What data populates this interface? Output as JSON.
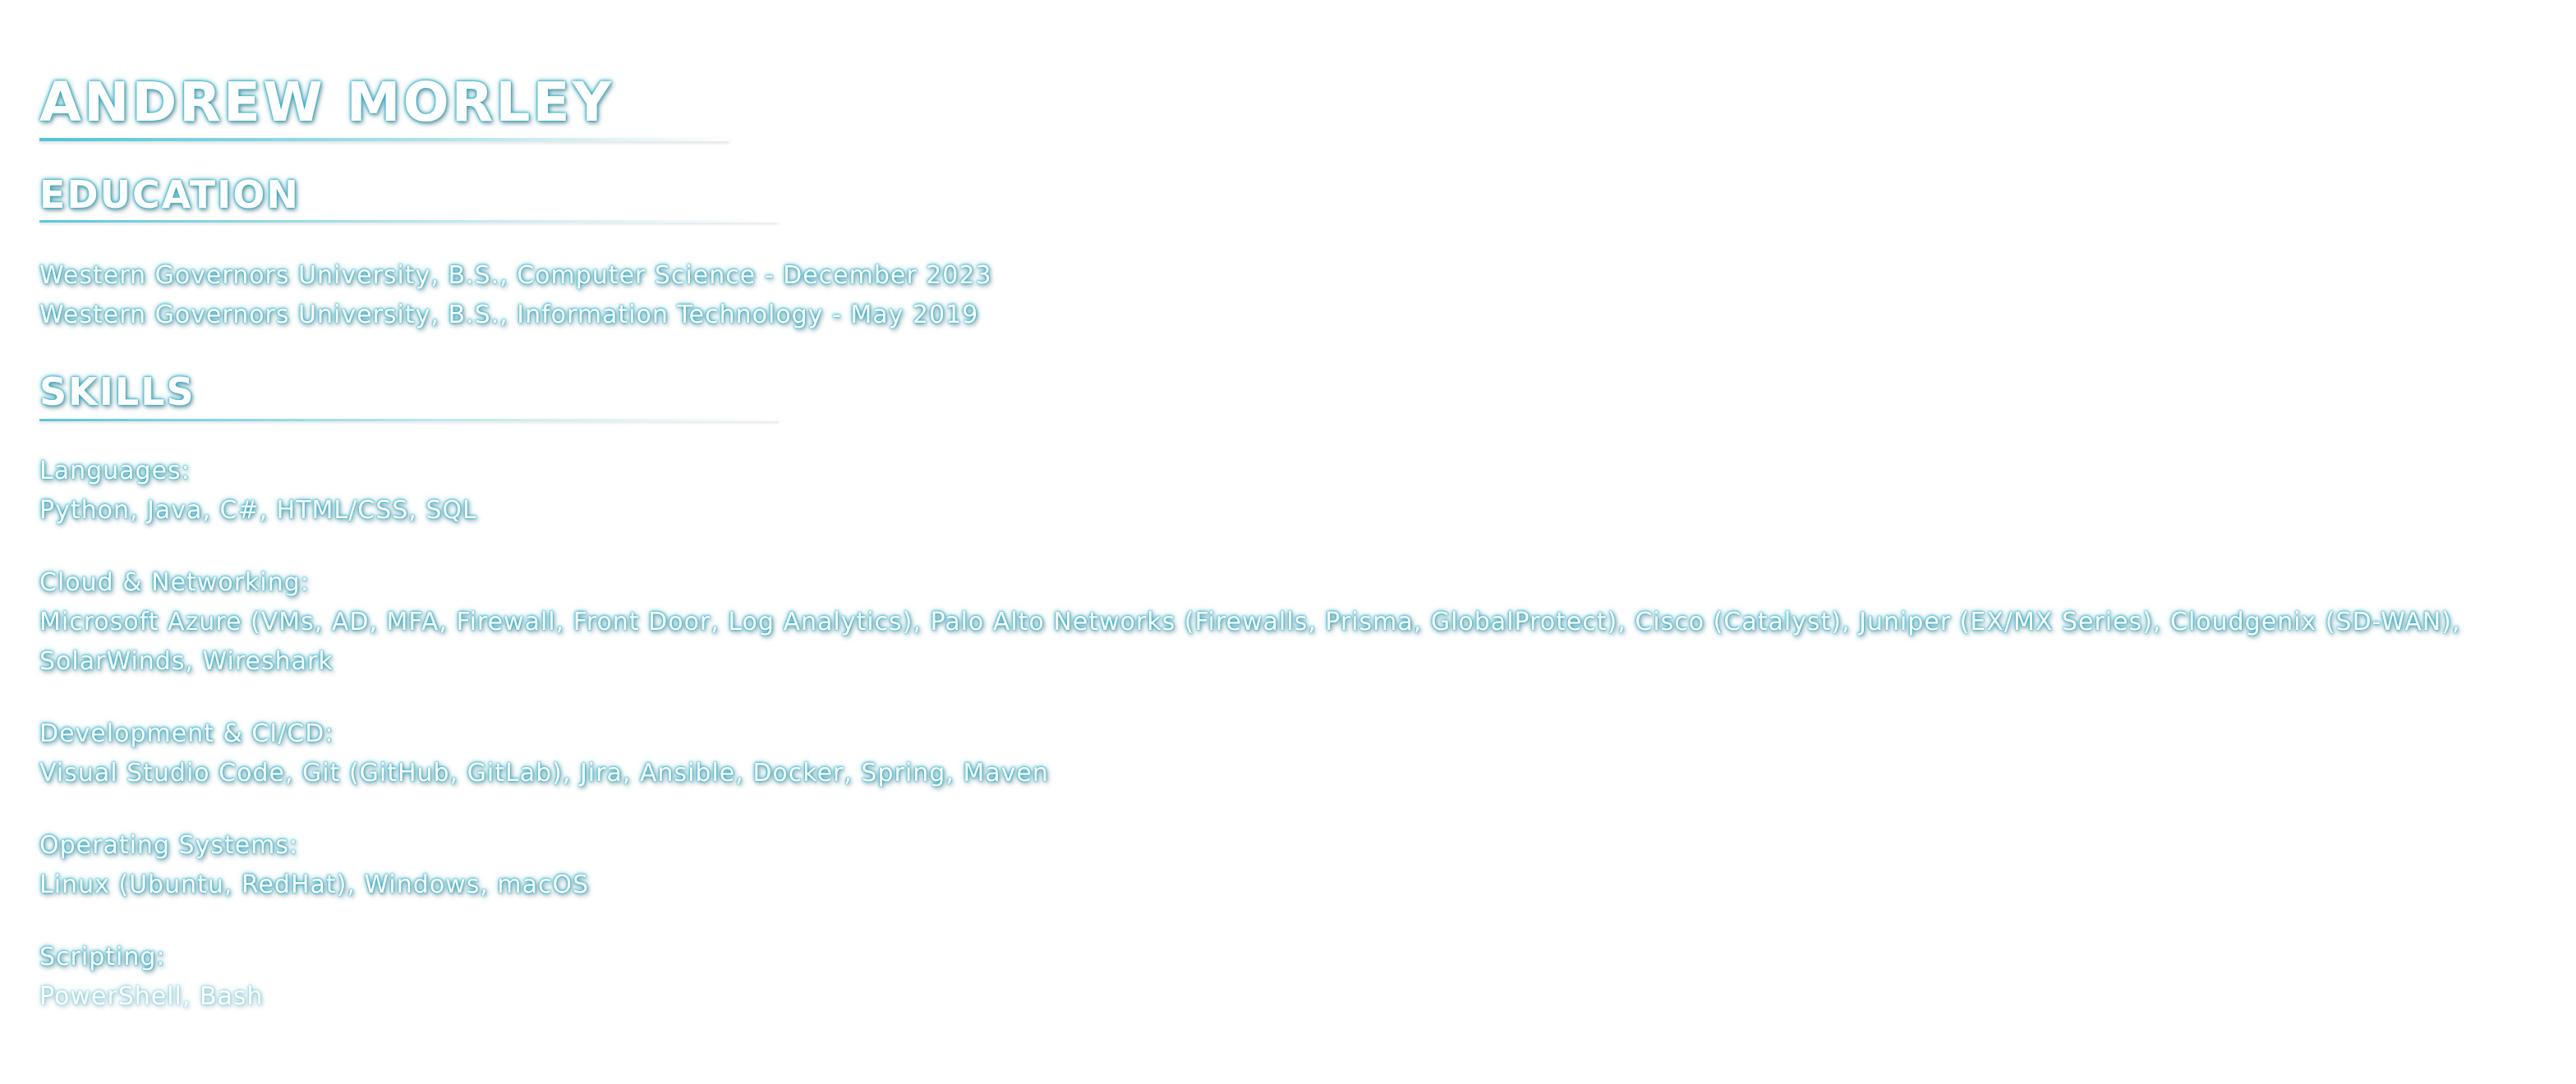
{
  "header": {
    "name": "ANDREW MORLEY"
  },
  "education": {
    "title": "EDUCATION",
    "entries": [
      "Western Governors University, B.S., Computer Science - December 2023",
      "Western Governors University, B.S., Information Technology - May 2019"
    ]
  },
  "skills": {
    "title": "SKILLS",
    "groups": [
      {
        "label": "Languages:",
        "value": "Python, Java, C#, HTML/CSS, SQL"
      },
      {
        "label": "Cloud & Networking:",
        "value": "Microsoft Azure (VMs, AD, MFA, Firewall, Front Door, Log Analytics), Palo Alto Networks (Firewalls, Prisma, GlobalProtect), Cisco (Catalyst), Juniper (EX/MX Series), Cloudgenix (SD-WAN), SolarWinds, Wireshark"
      },
      {
        "label": "Development & CI/CD:",
        "value": "Visual Studio Code, Git (GitHub, GitLab), Jira, Ansible, Docker, Spring, Maven"
      },
      {
        "label": "Operating Systems:",
        "value": "Linux (Ubuntu, RedHat), Windows, macOS"
      },
      {
        "label": "Scripting:",
        "value": "PowerShell, Bash"
      }
    ]
  },
  "colors": {
    "glow": "#2aa7bf",
    "text": "#ffffff",
    "background": "#ffffff"
  }
}
